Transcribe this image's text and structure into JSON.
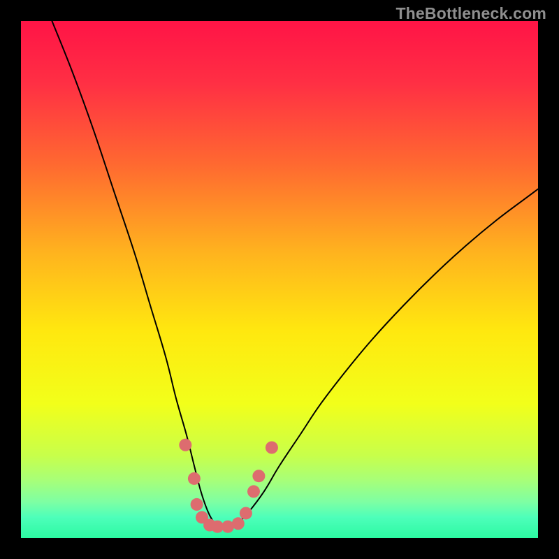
{
  "watermark": "TheBottleneck.com",
  "colors": {
    "background": "#000000",
    "curve": "#000000",
    "marker_fill": "#dd6c6f",
    "marker_stroke": "#b85657",
    "gradient_stops": [
      {
        "offset": 0.0,
        "color": "#ff1446"
      },
      {
        "offset": 0.12,
        "color": "#ff2f44"
      },
      {
        "offset": 0.28,
        "color": "#ff6a30"
      },
      {
        "offset": 0.45,
        "color": "#ffb41e"
      },
      {
        "offset": 0.6,
        "color": "#ffe80f"
      },
      {
        "offset": 0.74,
        "color": "#f2ff1a"
      },
      {
        "offset": 0.84,
        "color": "#c8ff4a"
      },
      {
        "offset": 0.89,
        "color": "#a6ff7a"
      },
      {
        "offset": 0.93,
        "color": "#7effa3"
      },
      {
        "offset": 0.96,
        "color": "#4dffba"
      },
      {
        "offset": 1.0,
        "color": "#2cf9a2"
      }
    ]
  },
  "chart_data": {
    "type": "line",
    "title": "",
    "xlabel": "",
    "ylabel": "",
    "xlim": [
      0,
      100
    ],
    "ylim": [
      0,
      100
    ],
    "series": [
      {
        "name": "bottleneck-curve",
        "x": [
          6,
          10,
          14,
          18,
          22,
          25,
          28,
          30,
          32,
          33.5,
          34.8,
          36,
          37,
          38,
          40,
          42,
          44,
          47,
          50,
          54,
          58,
          63,
          68,
          74,
          80,
          86,
          92,
          98,
          100
        ],
        "values": [
          100,
          90,
          79,
          67,
          55,
          45,
          35,
          27,
          20,
          14,
          9,
          5.5,
          3.5,
          2.5,
          2,
          3,
          5,
          9,
          14,
          20,
          26,
          32.5,
          38.5,
          45,
          51,
          56.5,
          61.5,
          66,
          67.5
        ]
      }
    ],
    "markers": [
      {
        "x": 31.8,
        "y": 18.0
      },
      {
        "x": 33.5,
        "y": 11.5
      },
      {
        "x": 34.0,
        "y": 6.5
      },
      {
        "x": 35.0,
        "y": 4.0
      },
      {
        "x": 36.5,
        "y": 2.5
      },
      {
        "x": 38.0,
        "y": 2.2
      },
      {
        "x": 40.0,
        "y": 2.2
      },
      {
        "x": 42.0,
        "y": 2.8
      },
      {
        "x": 43.5,
        "y": 4.8
      },
      {
        "x": 45.0,
        "y": 9.0
      },
      {
        "x": 46.0,
        "y": 12.0
      },
      {
        "x": 48.5,
        "y": 17.5
      }
    ]
  }
}
